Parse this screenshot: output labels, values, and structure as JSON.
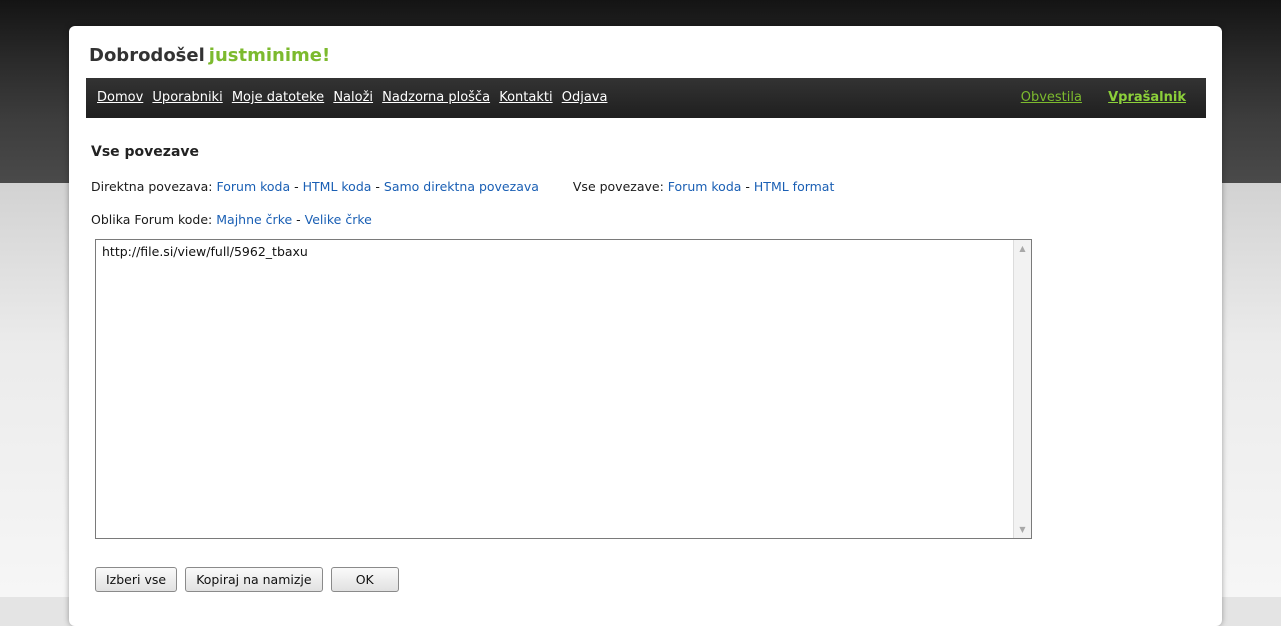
{
  "header": {
    "welcome": "Dobrodošel",
    "username": "justminime!"
  },
  "nav": {
    "items": [
      "Domov",
      "Uporabniki",
      "Moje datoteke",
      "Naloži",
      "Nadzorna plošča",
      "Kontakti",
      "Odjava"
    ],
    "right": {
      "notices": "Obvestila",
      "survey": "Vprašalnik"
    }
  },
  "section": {
    "title": "Vse povezave"
  },
  "direct_links": {
    "label": "Direktna povezava:",
    "forum": "Forum koda",
    "sep1": "-",
    "html": "HTML koda",
    "sep2": "-",
    "direct": "Samo direktna povezava"
  },
  "all_links": {
    "label": "Vse povezave:",
    "forum": "Forum koda",
    "sep": "-",
    "html": "HTML format"
  },
  "forum_format": {
    "label": "Oblika Forum kode:",
    "lower": "Majhne črke",
    "sep": "-",
    "upper": "Velike črke"
  },
  "output": {
    "value": "http://file.si/view/full/5962_tbaxu"
  },
  "buttons": {
    "select_all": "Izberi vse",
    "copy": "Kopiraj na namizje",
    "ok": "OK"
  },
  "colors": {
    "accent": "#7cba2e",
    "link": "#1a5fb4",
    "navbar": "#2b2b2b"
  }
}
